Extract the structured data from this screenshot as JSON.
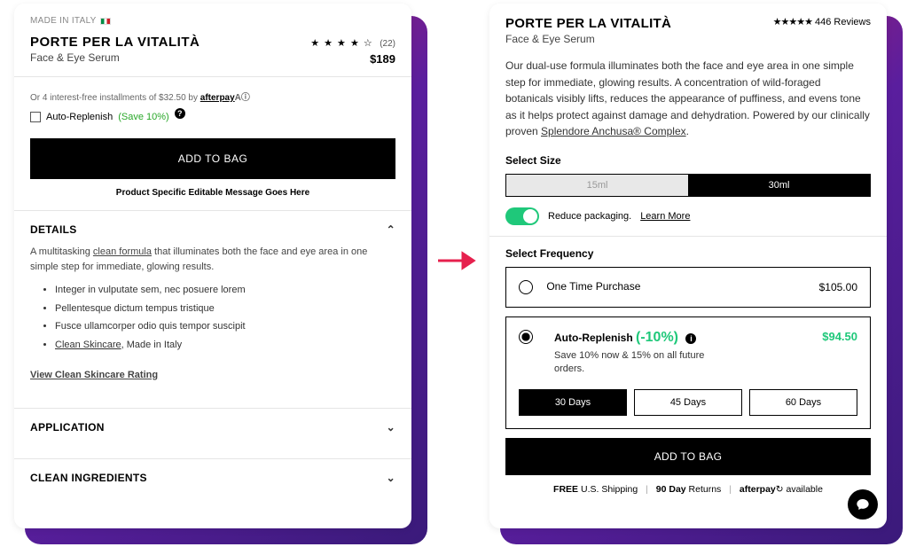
{
  "left": {
    "madein": "MADE IN ITALY",
    "title": "PORTE PER LA VITALITÀ",
    "subtitle": "Face & Eye Serum",
    "rating_stars": "★ ★ ★ ★ ☆",
    "review_count": "(22)",
    "price": "$189",
    "afterpay_prefix": "Or 4 interest-free installments of $32.50 by ",
    "afterpay_brand": "afterpay",
    "afterpay_sym": "Aⓘ",
    "autoreplenish_label": "Auto-Replenish ",
    "autoreplenish_save": "(Save 10%)",
    "add_button": "ADD TO BAG",
    "psm": "Product Specific Editable Message Goes Here",
    "details": {
      "head": "DETAILS",
      "body_pre": "A multitasking ",
      "body_link": "clean formula",
      "body_post": " that illuminates both the face and eye area in one simple step for immediate, glowing results.",
      "bullets": [
        "Integer in vulputate sem, nec posuere lorem",
        "Pellentesque dictum tempus tristique",
        "Fusce ullamcorper odio quis tempor suscipit",
        "Clean Skincare, Made in Italy"
      ],
      "bullet3_pre": "",
      "bullet3_link": "Clean Skincare",
      "bullet3_post": ", Made in Italy",
      "viewlink": "View Clean Skincare Rating"
    },
    "acc_application": "APPLICATION",
    "acc_ingredients": "CLEAN INGREDIENTS"
  },
  "right": {
    "title": "PORTE PER LA VITALITÀ",
    "subtitle": "Face & Eye Serum",
    "stars": "★★★★★",
    "review_count": "446 Reviews",
    "description_pre": "Our dual-use formula illuminates both the face and eye area in one simple step for immediate, glowing results. A concentration of wild-foraged botanicals visibly lifts, reduces the appearance of puffiness, and evens tone as it helps protect against damage and dehydration. Powered by our clinically proven ",
    "description_link": "Splendore Anchusa® Complex",
    "description_post": ".",
    "size_label": "Select Size",
    "size_opt_disabled": "15ml",
    "size_opt_active": "30ml",
    "toggle_text": "Reduce packaging. ",
    "toggle_learn": "Learn More",
    "freq_label": "Select Frequency",
    "onetime_label": "One Time Purchase",
    "onetime_price": "$105.00",
    "ar_label": "Auto-Replenish ",
    "ar_disc": "(-10%)",
    "ar_sub": "Save 10% now & 15% on all future orders.",
    "ar_price": "$94.50",
    "periods": [
      "30 Days",
      "45 Days",
      "60 Days"
    ],
    "add_button": "ADD TO BAG",
    "footer_free": "FREE",
    "footer_ship": " U.S. Shipping",
    "footer_90": "90 Day",
    "footer_returns": " Returns",
    "footer_afterpay": "afterpay",
    "footer_avail": " available"
  }
}
